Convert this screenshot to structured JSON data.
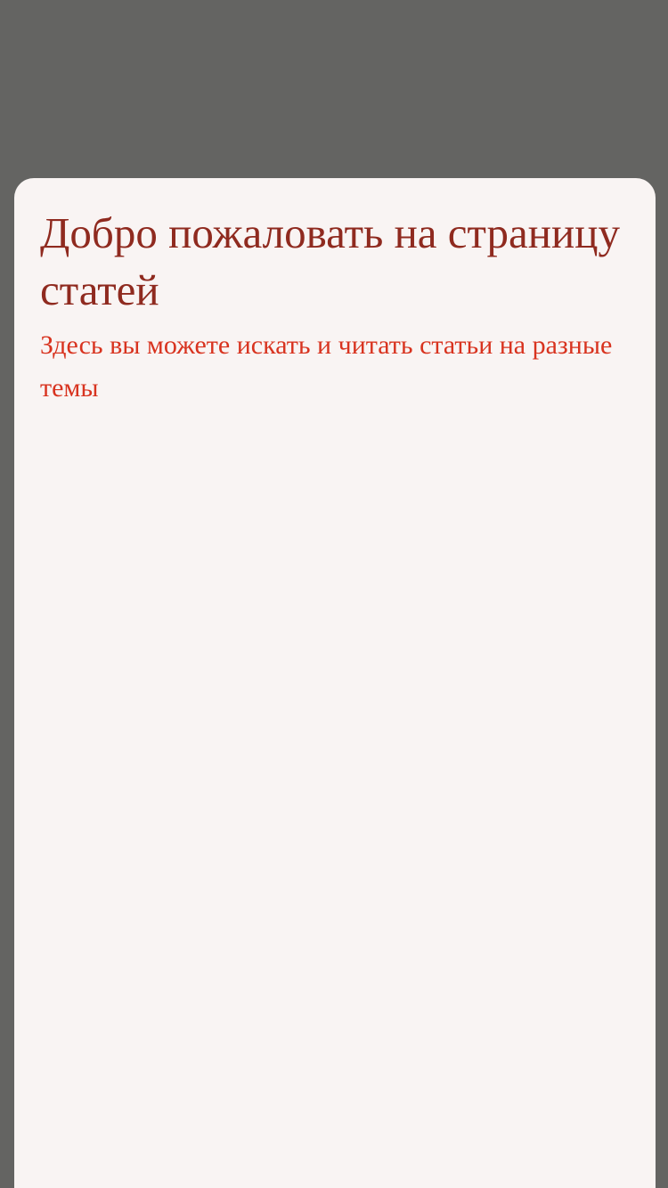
{
  "sheet": {
    "title": "Добро пожаловать на страницу статей",
    "subtitle": "Здесь вы можете искать и читать статьи на разные темы"
  },
  "colors": {
    "backdrop": "#646462",
    "sheet_background": "#f9f4f3",
    "title": "#8f2a1f",
    "subtitle": "#d8331f"
  }
}
